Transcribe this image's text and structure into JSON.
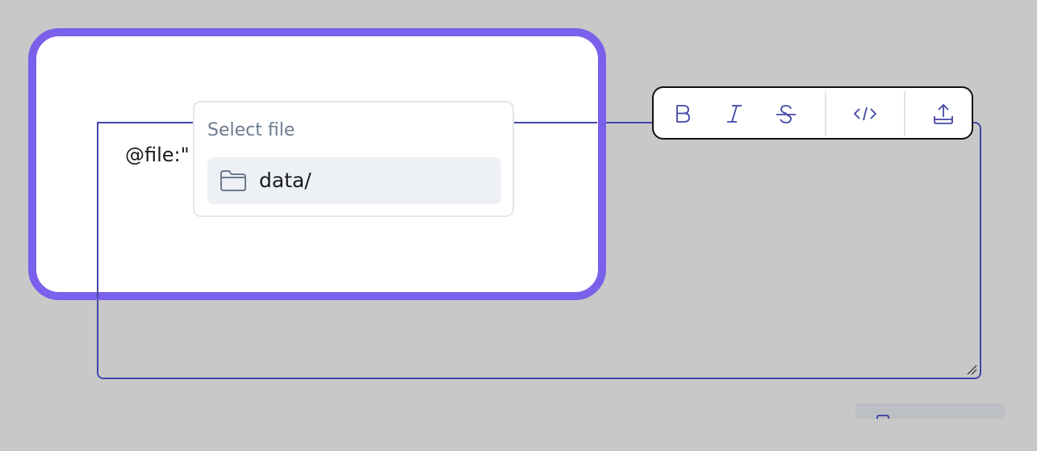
{
  "editor": {
    "text": "@file:\""
  },
  "file_picker": {
    "title": "Select file",
    "items": [
      {
        "label": "data/",
        "icon": "folder-icon"
      }
    ]
  },
  "toolbar": {
    "buttons": [
      {
        "name": "bold",
        "icon": "bold-icon"
      },
      {
        "name": "italic",
        "icon": "italic-icon"
      },
      {
        "name": "strikethrough",
        "icon": "strikethrough-icon"
      },
      {
        "name": "code",
        "icon": "code-icon"
      },
      {
        "name": "upload",
        "icon": "upload-icon"
      }
    ]
  },
  "colors": {
    "background": "#c8c8c8",
    "accent": "#4347a6",
    "highlight": "#7a60ea",
    "row_hover": "#edf1f5",
    "muted_text": "#6e7b8e"
  }
}
